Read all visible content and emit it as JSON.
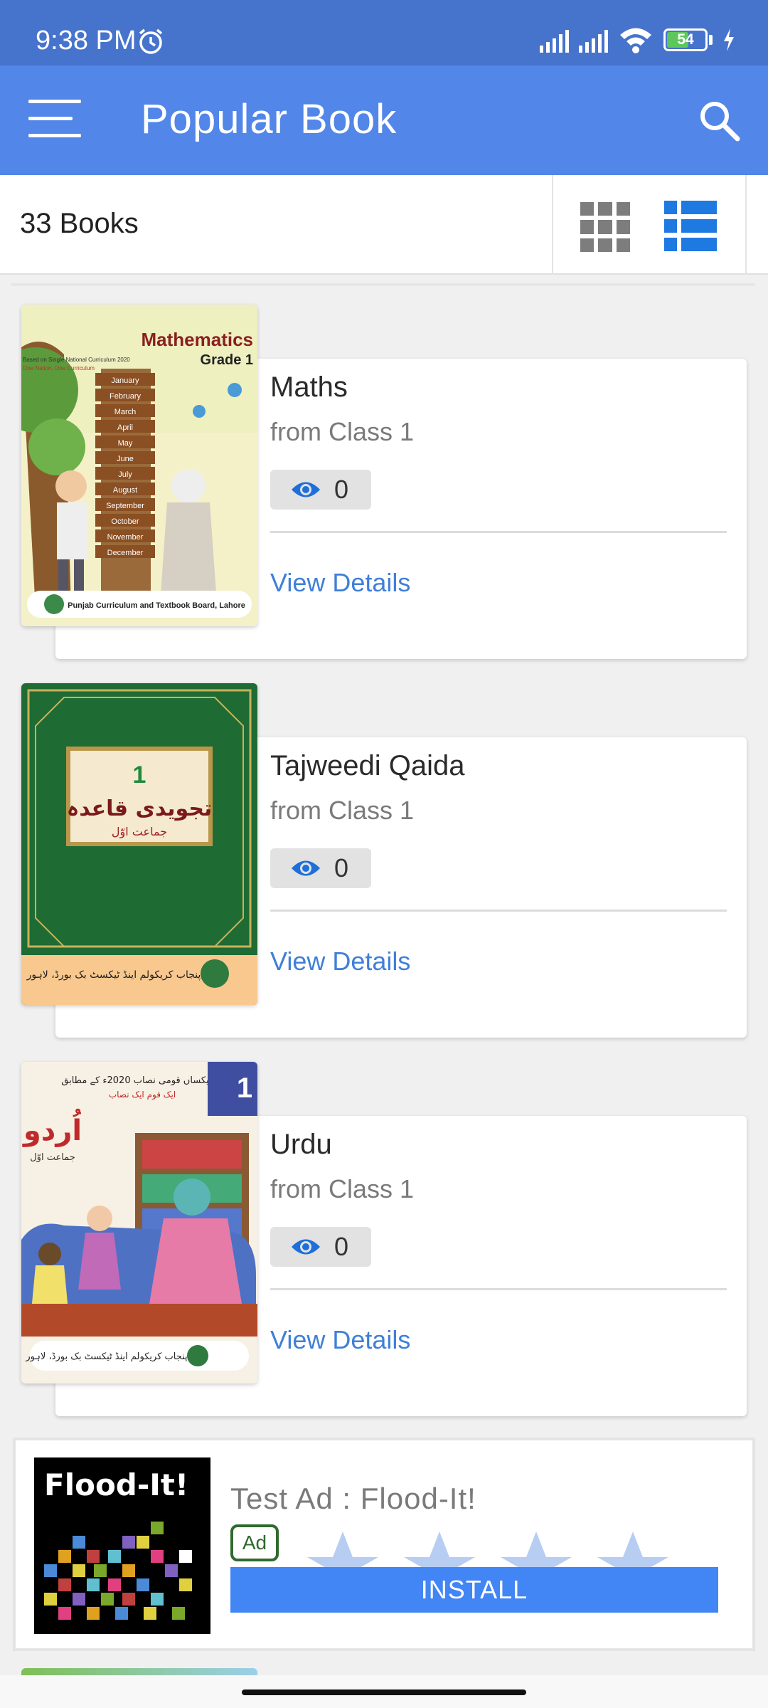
{
  "status_bar": {
    "time": "9:38 PM",
    "battery": "54",
    "icons": [
      "alarm-icon",
      "signal-icon",
      "signal-icon",
      "wifi-icon",
      "battery-icon",
      "charging-icon"
    ]
  },
  "app_bar": {
    "title": "Popular Book",
    "menu_icon": "menu-icon",
    "search_icon": "search-icon"
  },
  "toolbar": {
    "count": "33 Books",
    "grid_view_icon": "grid-view-icon",
    "list_view_icon": "list-view-icon",
    "active_view": "list"
  },
  "books": [
    {
      "title": "Maths",
      "class": "from Class 1",
      "views": "0",
      "action": "View Details",
      "cover": {
        "heading": "Mathematics",
        "subheading": "Grade 1",
        "note": "Based on Single National Curriculum 2020",
        "note2": "One Nation, One Curriculum",
        "months": [
          "January",
          "February",
          "March",
          "April",
          "May",
          "June",
          "July",
          "August",
          "September",
          "October",
          "November",
          "December"
        ],
        "publisher": "Punjab Curriculum and Textbook Board, Lahore"
      }
    },
    {
      "title": "Tajweedi Qaida",
      "class": "from Class 1",
      "views": "0",
      "action": "View Details",
      "cover": {
        "number": "1",
        "heading": "تجویدی قاعدہ",
        "subheading": "جماعت اوّل",
        "publisher": "پنجاب کریکولم اینڈ ٹیکسٹ بک بورڈ، لاہور"
      }
    },
    {
      "title": "Urdu",
      "class": "from Class 1",
      "views": "0",
      "action": "View Details",
      "cover": {
        "number": "1",
        "note": "یکساں قومی نصاب 2020ء کے مطابق",
        "note2": "ایک قوم ایک نصاب",
        "heading": "اُردو",
        "subheading": "جماعت اوّل",
        "publisher": "پنجاب کریکولم اینڈ ٹیکسٹ بک بورڈ، لاہور"
      }
    }
  ],
  "ad": {
    "image_title": "Flood-It!",
    "title": "Test Ad : Flood-It!",
    "badge": "Ad",
    "button": "INSTALL",
    "rating_stars": 5
  },
  "colors": {
    "status_bar": "#4673cc",
    "app_bar": "#5286e8",
    "accent": "#1e79e0",
    "link": "#3f7fd8",
    "install": "#4285f4"
  }
}
